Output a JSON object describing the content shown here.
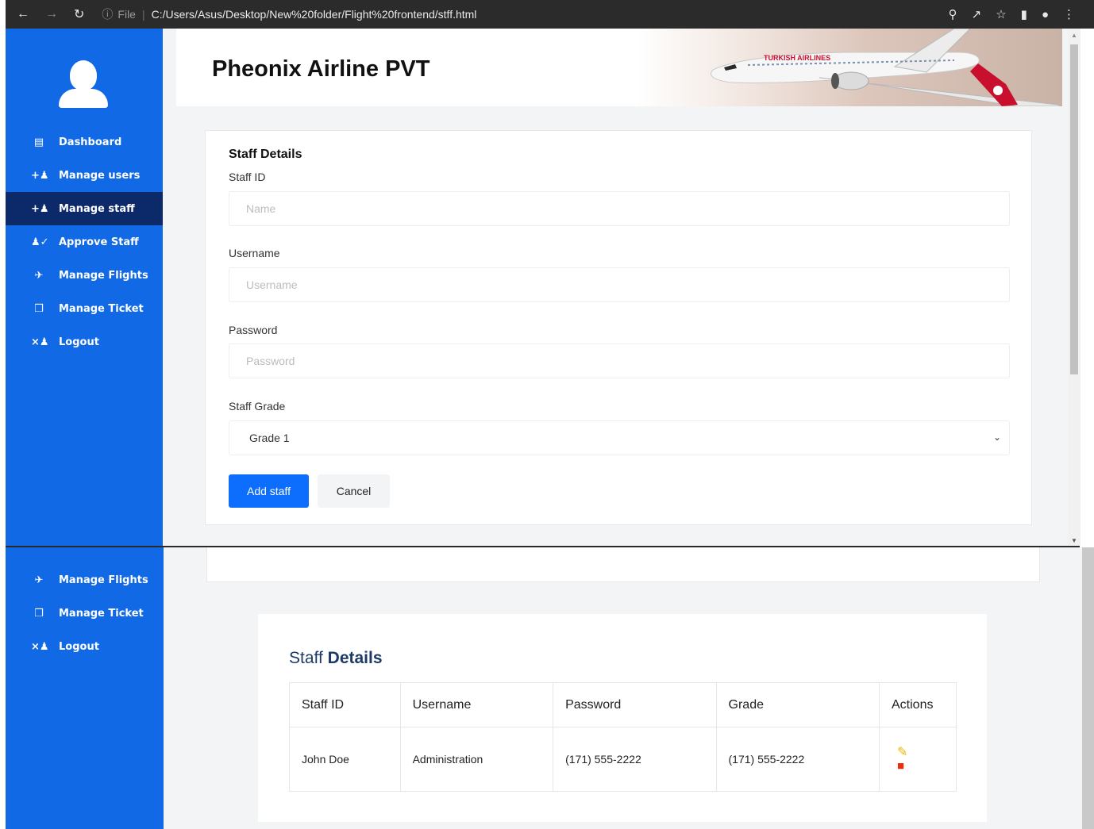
{
  "browser": {
    "file_label": "File",
    "url": "C:/Users/Asus/Desktop/New%20folder/Flight%20frontend/stff.html",
    "icons": [
      "back-icon",
      "forward-icon",
      "reload-icon",
      "info-icon",
      "zoom-icon",
      "share-icon",
      "bookmark-star-icon",
      "sidepanel-icon",
      "profile-icon",
      "menu-dots-icon"
    ]
  },
  "sidebar": {
    "items": [
      {
        "label": "Dashboard",
        "icon": "dashboard-icon"
      },
      {
        "label": "Manage users",
        "icon": "user-plus-icon"
      },
      {
        "label": "Manage staff",
        "icon": "user-plus-icon",
        "active": true
      },
      {
        "label": "Approve Staff",
        "icon": "user-check-icon"
      },
      {
        "label": "Manage Flights",
        "icon": "plane-icon"
      },
      {
        "label": "Manage Ticket",
        "icon": "ticket-icon"
      },
      {
        "label": "Logout",
        "icon": "user-x-icon"
      }
    ],
    "bottom_items": [
      {
        "label": "Manage Flights",
        "icon": "plane-icon"
      },
      {
        "label": "Manage Ticket",
        "icon": "ticket-icon"
      },
      {
        "label": "Logout",
        "icon": "user-x-icon"
      }
    ]
  },
  "header": {
    "title": "Pheonix Airline PVT",
    "banner_text": "TURKISH AIRLINES"
  },
  "form": {
    "title": "Staff Details",
    "staff_id_label": "Staff ID",
    "staff_id_placeholder": "Name",
    "username_label": "Username",
    "username_placeholder": "Username",
    "password_label": "Password",
    "password_placeholder": "Password",
    "grade_label": "Staff Grade",
    "grade_value": "Grade 1",
    "add_button": "Add staff",
    "cancel_button": "Cancel"
  },
  "table": {
    "title_first": "Staff",
    "title_second": "Details",
    "headers": [
      "Staff ID",
      "Username",
      "Password",
      "Grade",
      "Actions"
    ],
    "rows": [
      {
        "staff_id": "John Doe",
        "username": "Administration",
        "password": "(171) 555-2222",
        "grade": "(171) 555-2222"
      }
    ]
  },
  "colors": {
    "sidebar": "#1169e6",
    "sidebar_active": "#0c2a6a",
    "primary_button": "#0d6efd",
    "edit_icon": "#f0b400",
    "delete_icon": "#e8300f"
  }
}
